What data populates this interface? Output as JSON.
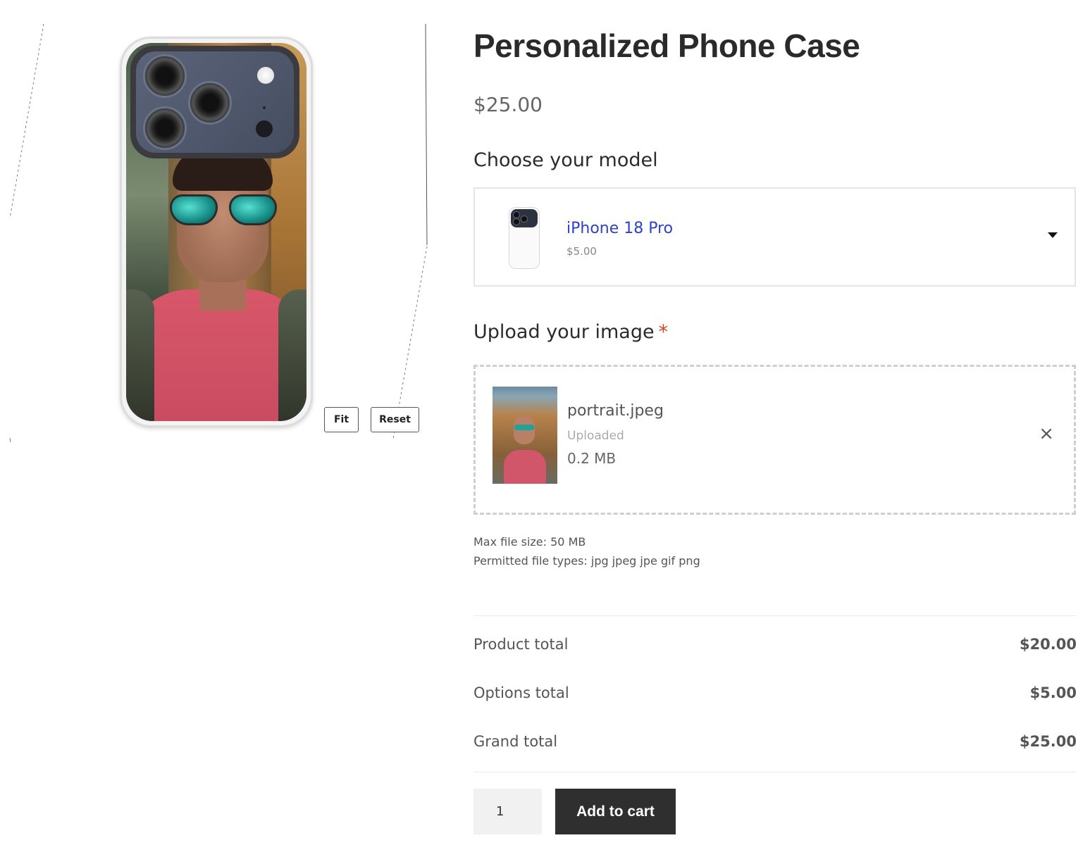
{
  "product": {
    "title": "Personalized Phone Case",
    "price": "$25.00"
  },
  "preview": {
    "fit_label": "Fit",
    "reset_label": "Reset"
  },
  "model_select": {
    "label": "Choose your model",
    "selected_name": "iPhone 18 Pro",
    "selected_price": "$5.00"
  },
  "upload": {
    "label": "Upload your image",
    "required_mark": "*",
    "file_name": "portrait.jpeg",
    "file_status": "Uploaded",
    "file_size": "0.2 MB",
    "remove_icon": "×",
    "max_size_note": "Max file size: 50 MB",
    "types_note": "Permitted file types: jpg jpeg jpe gif png"
  },
  "totals": {
    "product_label": "Product total",
    "product_value": "$20.00",
    "options_label": "Options total",
    "options_value": "$5.00",
    "grand_label": "Grand total",
    "grand_value": "$25.00"
  },
  "cart": {
    "quantity": "1",
    "add_label": "Add to cart"
  },
  "colors": {
    "accent_link": "#2e41c8",
    "button_dark": "#2f2f2f",
    "required": "#d0451b"
  }
}
